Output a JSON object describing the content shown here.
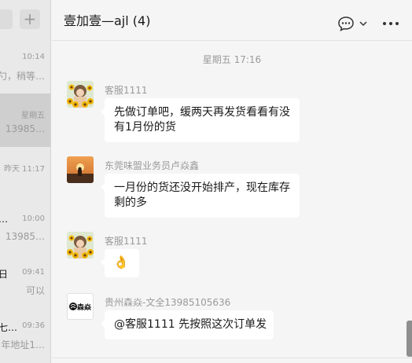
{
  "sidebar": {
    "add_label": "+",
    "conversations": [
      {
        "time": "10:14",
        "name": "",
        "preview": "勺，稍等…"
      },
      {
        "time": "星期五",
        "name": "",
        "preview": "13985…"
      },
      {
        "time": "昨天 11:17",
        "name": "",
        "preview": ""
      },
      {
        "time": "10:00",
        "name": "…",
        "preview": "13985…"
      },
      {
        "time": "09:41",
        "name": "日",
        "preview": "可以"
      },
      {
        "time": "09:36",
        "name": "七…",
        "preview": "年地址1…"
      }
    ]
  },
  "header": {
    "title": "壹加壹—ajl (4)"
  },
  "chat": {
    "date_divider": "星期五 17:16",
    "messages": [
      {
        "sender": "客服1111",
        "text_line1": "先做订单吧，缓两天再发货看看有没",
        "text_line2": "有1月份的货",
        "avatar": "sunflower-avatar"
      },
      {
        "sender": "东莞味盟业务员卢焱鑫",
        "text_line1": "一月份的货还没开始排产，现在库存",
        "text_line2": "剩的多",
        "avatar": "sunset-avatar"
      },
      {
        "sender": "客服1111",
        "emoji": "👌",
        "avatar": "sunflower-avatar"
      },
      {
        "sender": "贵州森焱-文全13985105636",
        "text_line1": "@客服1111 先按照这次订单发",
        "avatar_text": "森焱"
      }
    ]
  },
  "colors": {
    "sidebar_bg": "#e9e9e9",
    "chat_bg": "#f5f5f5",
    "bubble_bg": "#ffffff",
    "muted_text": "#9a9a9a"
  }
}
